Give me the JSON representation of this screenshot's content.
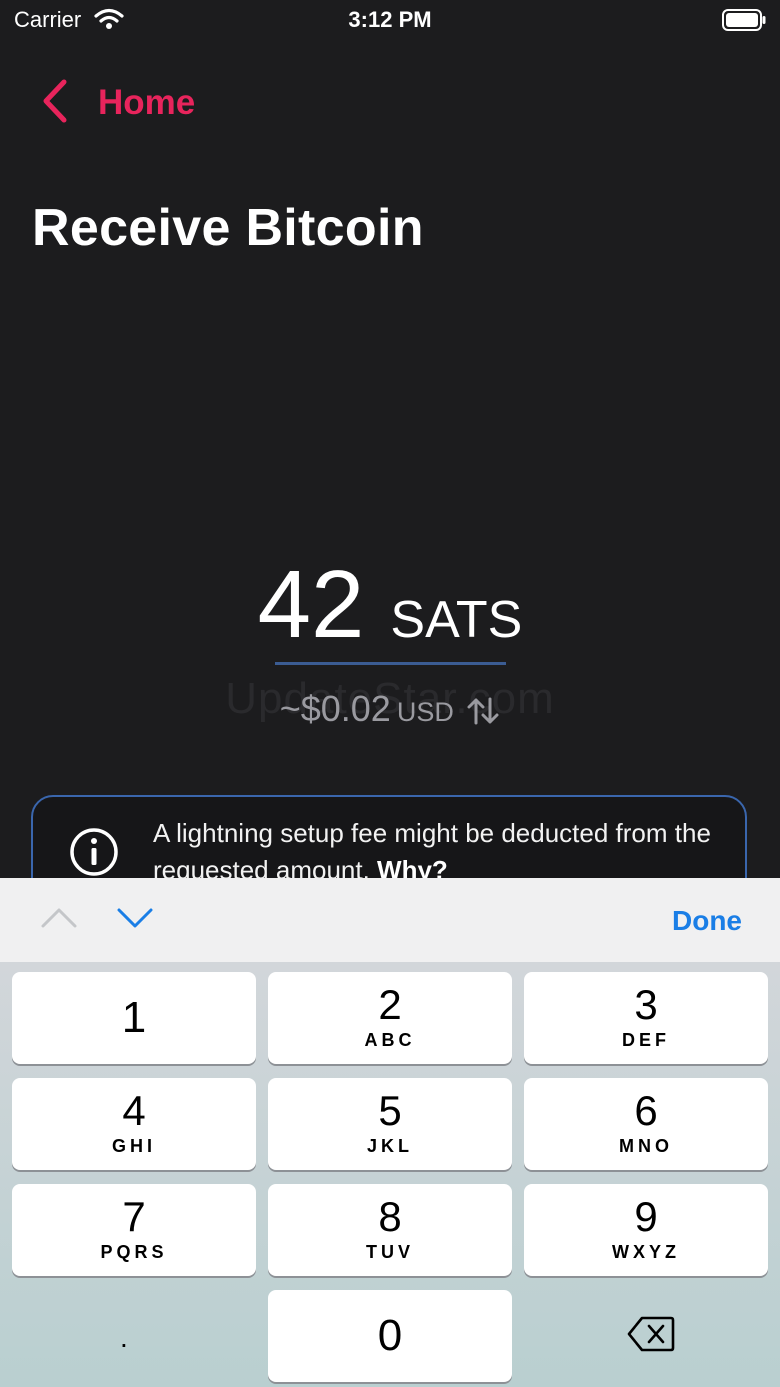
{
  "status_bar": {
    "carrier": "Carrier",
    "time": "3:12 PM"
  },
  "nav": {
    "back_label": "Home"
  },
  "page": {
    "title": "Receive Bitcoin"
  },
  "amount": {
    "value": "42",
    "unit": "SATS"
  },
  "fiat": {
    "value": "~$0.02",
    "unit": "USD"
  },
  "watermark": "UpdateStar.com",
  "info": {
    "text": "A lightning setup fee might be deducted from the requested amount.",
    "link": "Why?"
  },
  "toolbar": {
    "done_label": "Done"
  },
  "keypad": {
    "keys": [
      {
        "digit": "1",
        "letters": ""
      },
      {
        "digit": "2",
        "letters": "ABC"
      },
      {
        "digit": "3",
        "letters": "DEF"
      },
      {
        "digit": "4",
        "letters": "GHI"
      },
      {
        "digit": "5",
        "letters": "JKL"
      },
      {
        "digit": "6",
        "letters": "MNO"
      },
      {
        "digit": "7",
        "letters": "PQRS"
      },
      {
        "digit": "8",
        "letters": "TUV"
      },
      {
        "digit": "9",
        "letters": "WXYZ"
      },
      {
        "digit": "0",
        "letters": ""
      }
    ],
    "decimal": "."
  },
  "colors": {
    "accent": "#e8245c",
    "background": "#1c1c1e",
    "info_border": "#3a66ad",
    "done": "#1a7ee6"
  }
}
